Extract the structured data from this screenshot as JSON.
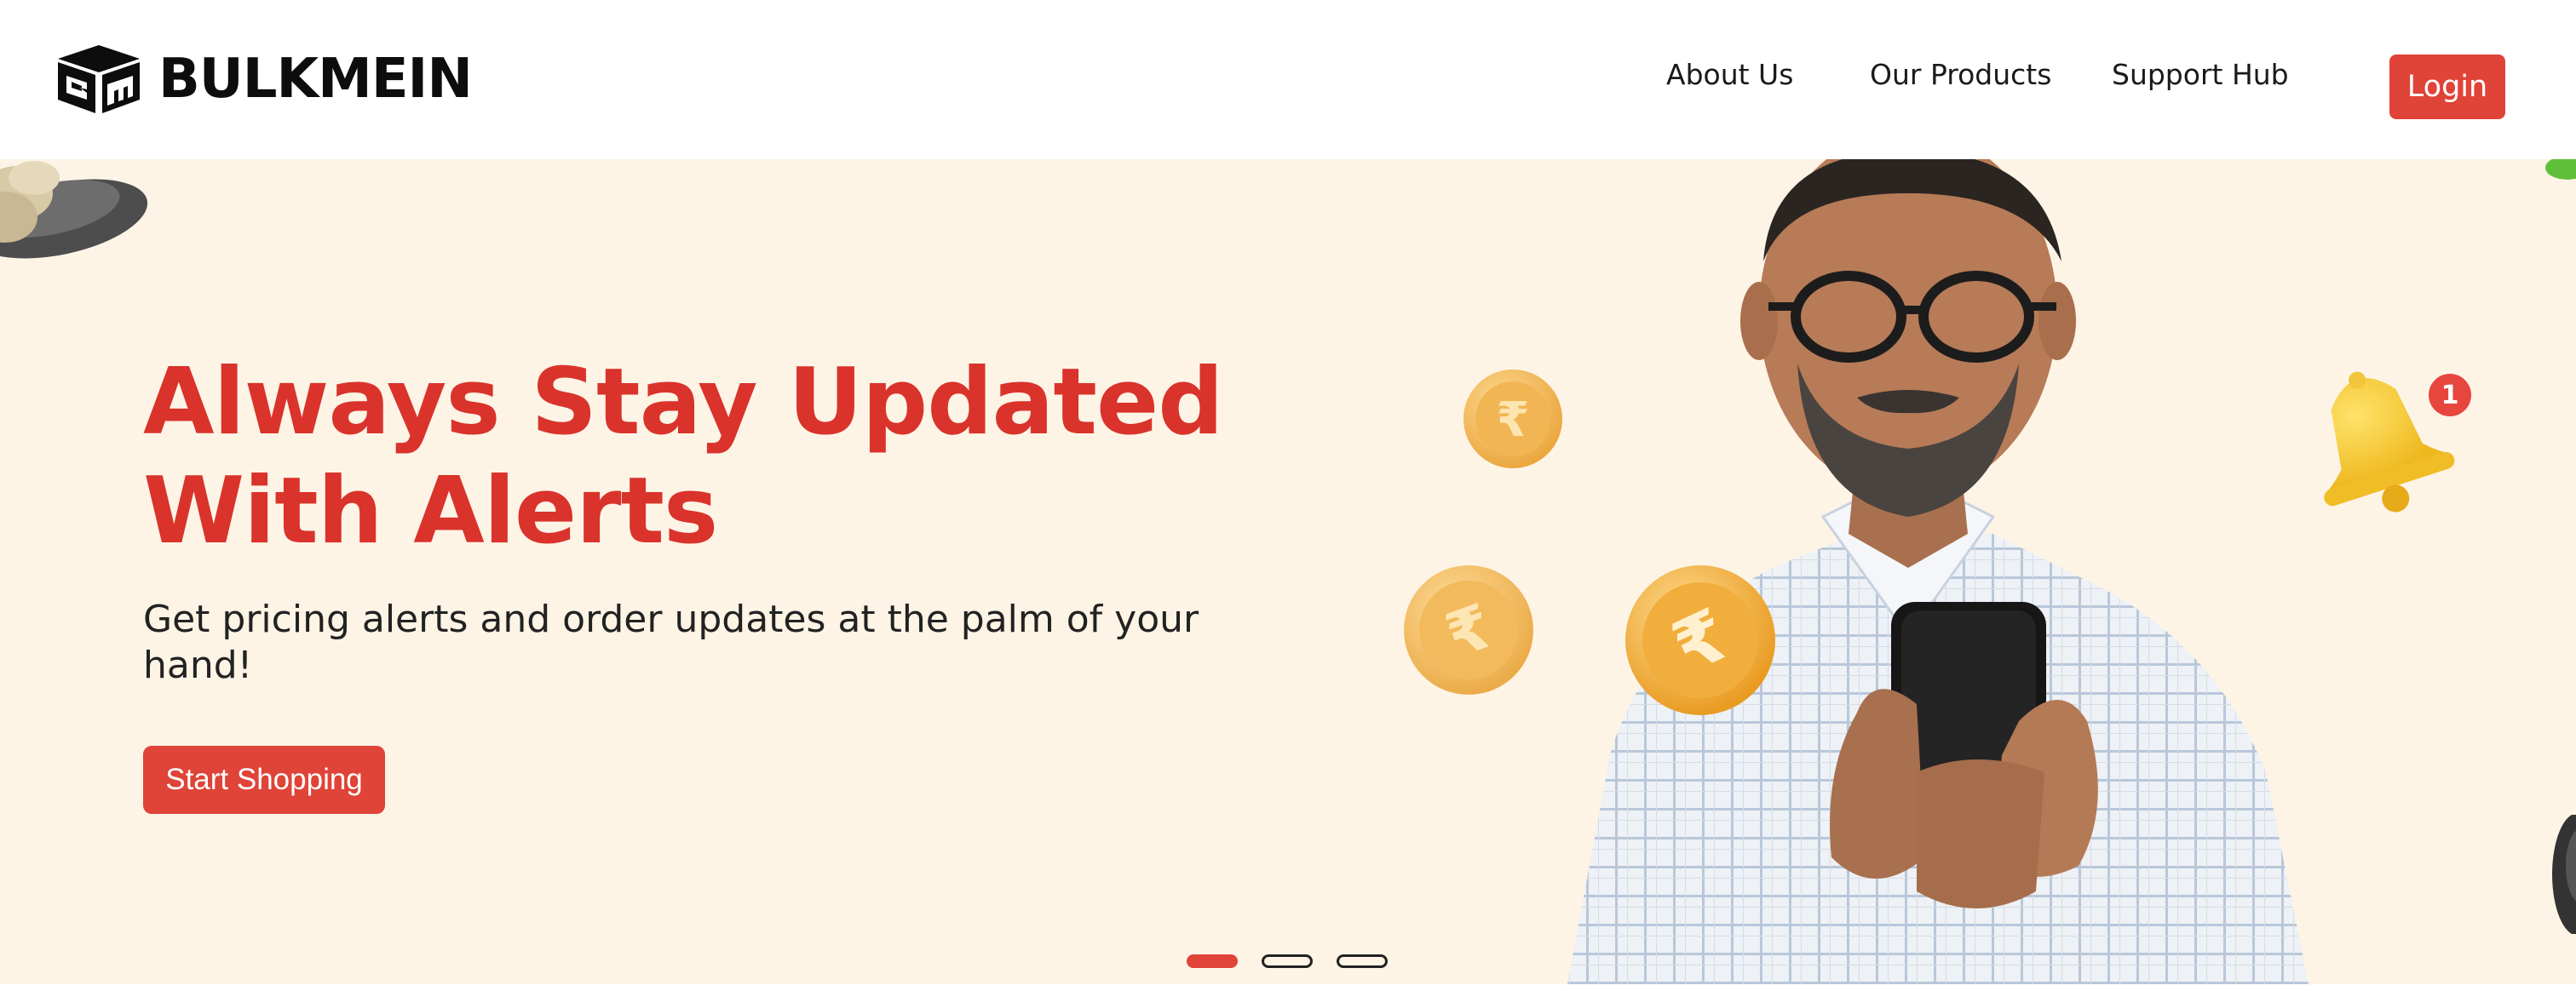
{
  "brand": {
    "name": "BULKMEIN",
    "icon": "bm-box-logo-icon"
  },
  "nav": {
    "items": [
      {
        "label": "About Us"
      },
      {
        "label": "Our Products"
      },
      {
        "label": "Support Hub"
      }
    ],
    "login_label": "Login"
  },
  "hero": {
    "title_line1": "Always Stay Updated",
    "title_line2": "With Alerts",
    "subtitle": "Get pricing alerts and order updates at the palm of your hand!",
    "cta_label": "Start Shopping",
    "notification_count": "1",
    "carousel": {
      "total_slides": 3,
      "active_slide": 1
    }
  },
  "colors": {
    "accent": "#e04337",
    "title_red": "#d9332b",
    "hero_bg": "#fdf4e6",
    "coin_gold": "#f3b23c"
  }
}
